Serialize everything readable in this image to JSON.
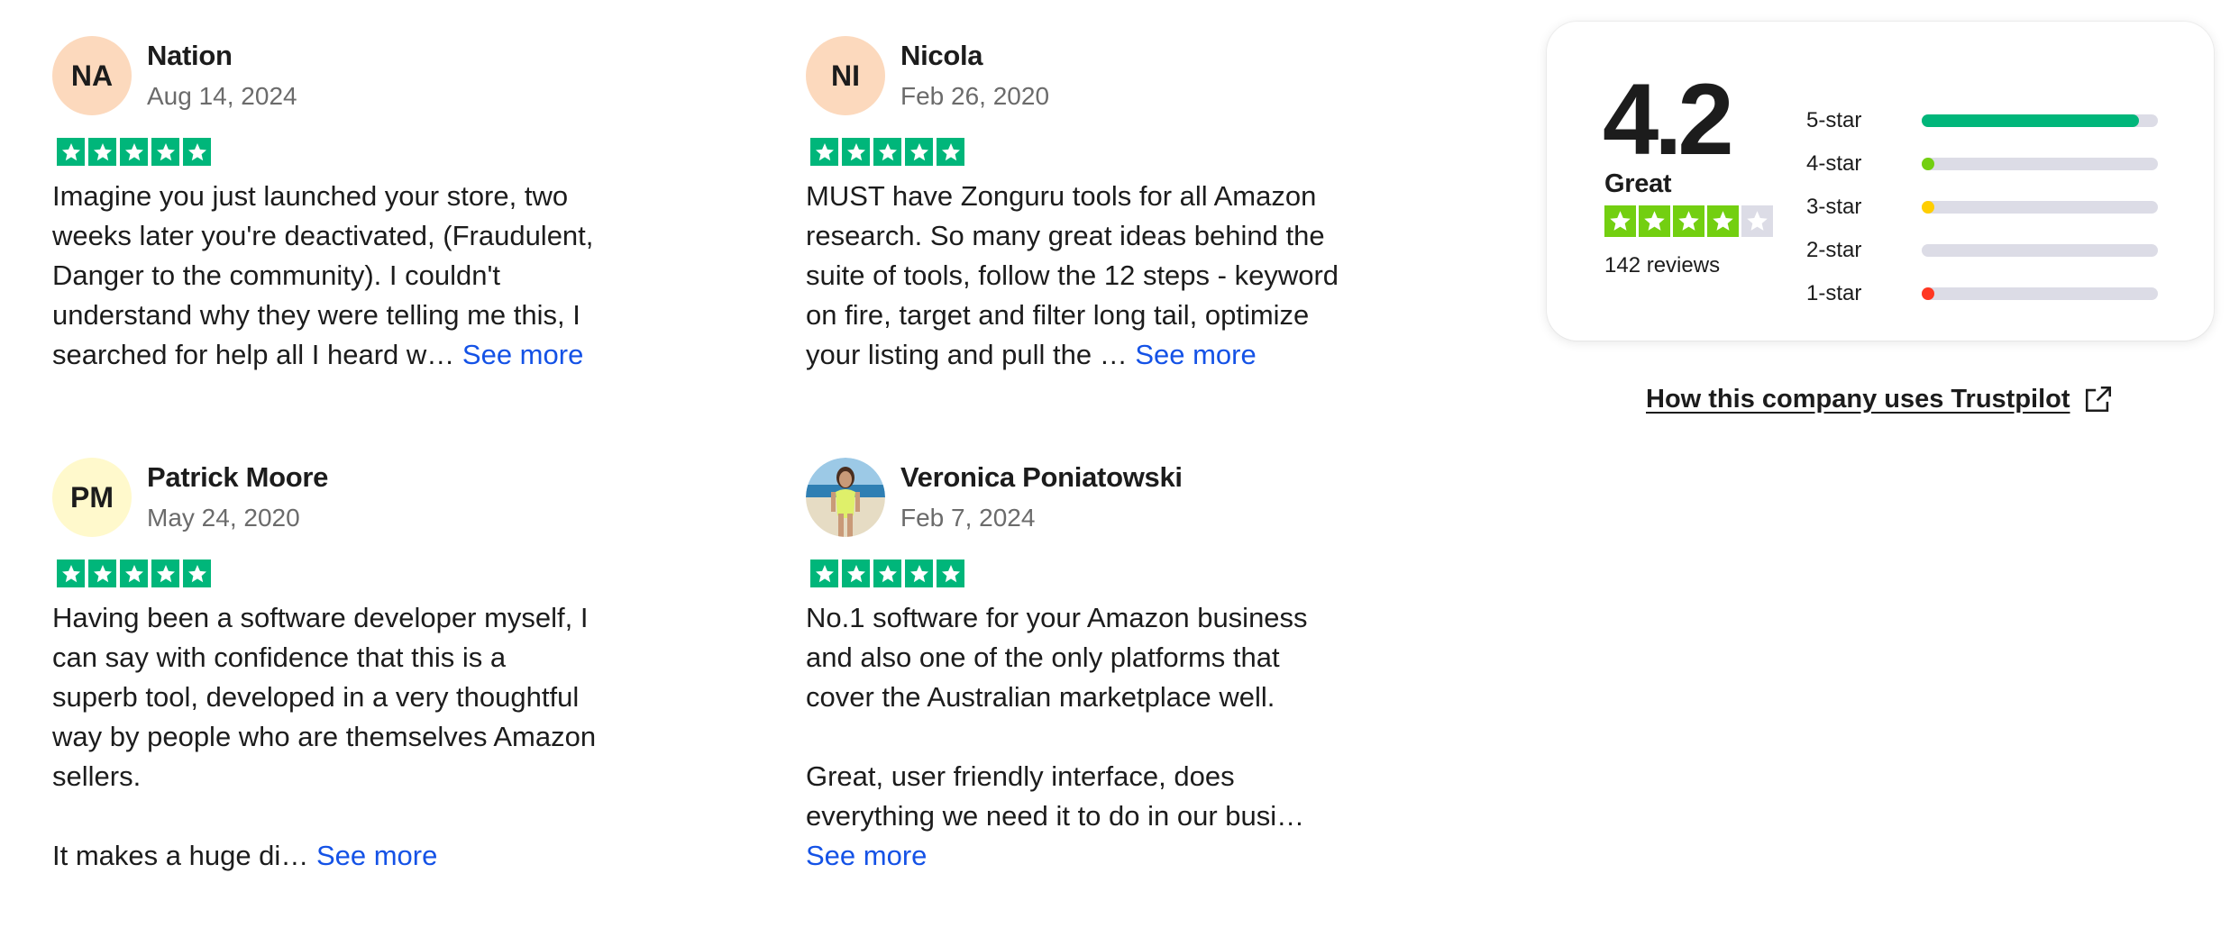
{
  "reviews": [
    {
      "initials": "NA",
      "avatar_color": "#fcd9bd",
      "name": "Nation",
      "date": "Aug 14, 2024",
      "rating": 5,
      "body": "Imagine you just launched your store, two\nweeks later you're deactivated, (Fraudulent,\nDanger to the community). I couldn't\nunderstand why they were telling me this, I\nsearched for help all I heard w… ",
      "see_more": "See more"
    },
    {
      "initials": "NI",
      "avatar_color": "#fcd9bd",
      "name": "Nicola",
      "date": "Feb 26, 2020",
      "rating": 5,
      "body": "MUST have Zonguru tools for all Amazon\nresearch. So many great ideas behind the\nsuite of tools, follow the 12 steps - keyword\non fire, target and filter long tail, optimize\nyour listing and pull the … ",
      "see_more": "See more"
    },
    {
      "initials": "PM",
      "avatar_color": "#fff9cc",
      "name": "Patrick Moore",
      "date": "May 24, 2020",
      "rating": 5,
      "body": "Having been a software developer myself, I\ncan say with confidence that this is a\nsuperb tool, developed in a very thoughtful\nway by people who are themselves Amazon\nsellers.\n\nIt makes a huge di… ",
      "see_more": "See more"
    },
    {
      "avatar_type": "photo",
      "name": "Veronica Poniatowski",
      "date": "Feb 7, 2024",
      "rating": 5,
      "body": "No.1 software for your Amazon business\nand also one of the only platforms that\ncover the Australian marketplace well.\n\nGreat, user friendly interface, does\neverything we need it to do in our busi…\n",
      "see_more": "See more"
    }
  ],
  "summary": {
    "score": "4.2",
    "verdict": "Great",
    "stars_filled": 4,
    "review_count": "142 reviews",
    "distribution": [
      {
        "label": "5-star",
        "fraction": 0.92,
        "color": "#00b67a"
      },
      {
        "label": "4-star",
        "fraction": 0.02,
        "color": "#73cf11"
      },
      {
        "label": "3-star",
        "fraction": 0.01,
        "color": "#ffce00"
      },
      {
        "label": "2-star",
        "fraction": 0.0,
        "color": "#ff8622"
      },
      {
        "label": "1-star",
        "fraction": 0.05,
        "color": "#ff3722"
      }
    ]
  },
  "company_link": "How this company uses Trustpilot",
  "colors": {
    "trustpilot_green": "#00b67a",
    "light_green": "#73cf11",
    "link_blue": "#1452e6",
    "empty_star": "#dcdce6"
  },
  "icons": {
    "star": "star-icon",
    "external_link": "external-link-icon"
  }
}
